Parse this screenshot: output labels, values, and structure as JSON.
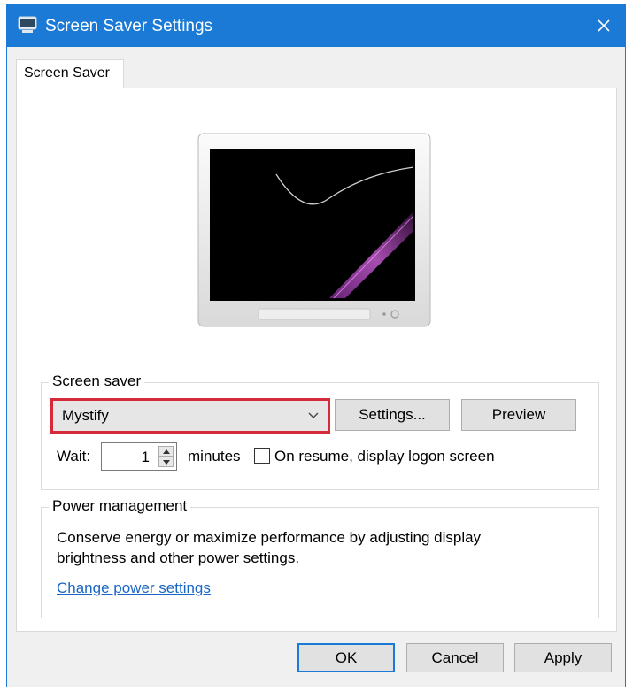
{
  "window": {
    "title": "Screen Saver Settings",
    "close_symbol": "✕"
  },
  "tab": {
    "label": "Screen Saver"
  },
  "screen_saver_group": {
    "legend": "Screen saver",
    "selected": "Mystify",
    "settings_label": "Settings...",
    "preview_label": "Preview",
    "wait_label": "Wait:",
    "wait_value": "1",
    "minutes_label": "minutes",
    "resume_checkbox_label": "On resume, display logon screen",
    "resume_checked": false
  },
  "power_group": {
    "legend": "Power management",
    "description_line1": "Conserve energy or maximize performance by adjusting display",
    "description_line2": "brightness and other power settings.",
    "link_text": "Change power settings"
  },
  "footer": {
    "ok_label": "OK",
    "cancel_label": "Cancel",
    "apply_label": "Apply"
  },
  "colors": {
    "titlebar": "#1a7ad6",
    "highlight_border": "#d62a3a",
    "link": "#1a66c4"
  }
}
